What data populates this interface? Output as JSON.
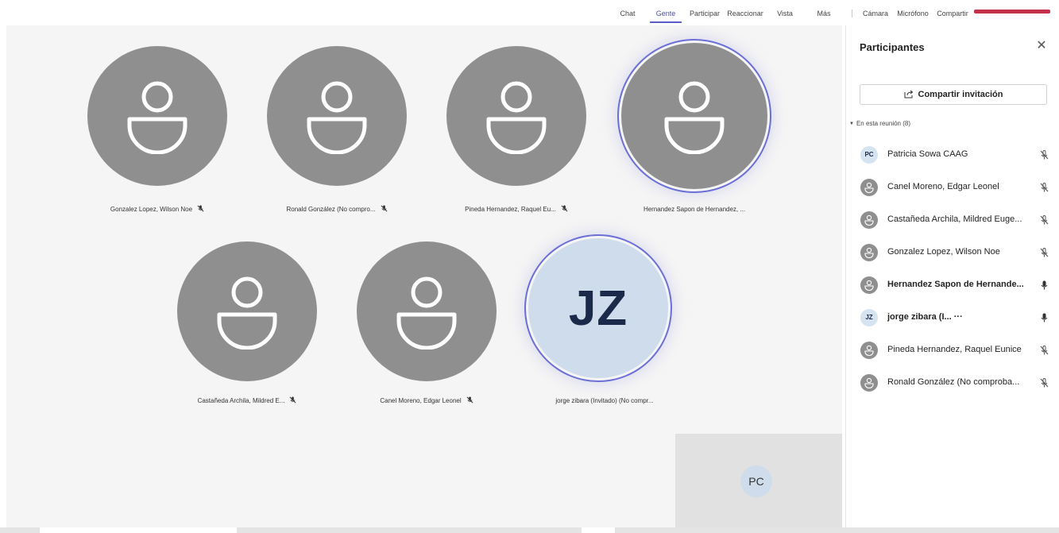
{
  "toolbar": {
    "items": [
      {
        "label": "Chat"
      },
      {
        "label": "Gente"
      },
      {
        "label": "Participar"
      },
      {
        "label": "Reaccionar"
      },
      {
        "label": "Vista"
      },
      {
        "label": "Más"
      },
      {
        "label": "Cámara"
      },
      {
        "label": "Micrófono"
      },
      {
        "label": "Compartir"
      }
    ],
    "active_item": "Gente"
  },
  "stage": {
    "tiles": [
      {
        "name": "Gonzalez Lopez, Wilson Noe",
        "muted": true,
        "speaking": false
      },
      {
        "name": "Ronald González (No compro...",
        "muted": true,
        "speaking": false
      },
      {
        "name": "Pineda Hernandez, Raquel Eu...",
        "muted": true,
        "speaking": false
      },
      {
        "name": "Hernandez Sapon de Hernandez, ...",
        "muted": false,
        "speaking": true
      },
      {
        "name": "Castañeda Archila, Mildred E...",
        "muted": true,
        "speaking": false
      },
      {
        "name": "Canel Moreno, Edgar Leonel",
        "muted": true,
        "speaking": false
      },
      {
        "name": "jorge zibara (Invitado) (No compr...",
        "muted": false,
        "speaking": true,
        "initials": "JZ"
      }
    ],
    "self_view": {
      "initials": "PC"
    }
  },
  "panel": {
    "title": "Participantes",
    "invite_label": "Compartir invitación",
    "section_label": "En esta reunión (8)",
    "participants": [
      {
        "name": "Patricia Sowa CAAG",
        "initials": "PC",
        "mic": "muted",
        "bold": false
      },
      {
        "name": "Canel Moreno, Edgar Leonel",
        "mic": "muted",
        "bold": false
      },
      {
        "name": "Castañeda Archila, Mildred Euge...",
        "mic": "muted",
        "bold": false
      },
      {
        "name": "Gonzalez Lopez, Wilson Noe",
        "mic": "muted",
        "bold": false
      },
      {
        "name": "Hernandez Sapon de Hernande...",
        "mic": "on",
        "bold": true
      },
      {
        "name": "jorge zibara (I... ···",
        "initials": "JZ",
        "mic": "on",
        "bold": true
      },
      {
        "name": "Pineda Hernandez, Raquel Eunice",
        "mic": "muted",
        "bold": false
      },
      {
        "name": "Ronald González (No comproba...",
        "mic": "muted",
        "bold": false
      }
    ]
  },
  "icons": {
    "close": "close-icon",
    "share": "share-icon",
    "mic_muted": "mic-off-icon",
    "mic_on": "mic-icon",
    "person": "person-icon"
  },
  "colors": {
    "accent": "#5b5fc7",
    "avatar_gray": "#8f8f8f",
    "initials_bg": "#cfdcec",
    "leave_red": "#c4314b"
  }
}
